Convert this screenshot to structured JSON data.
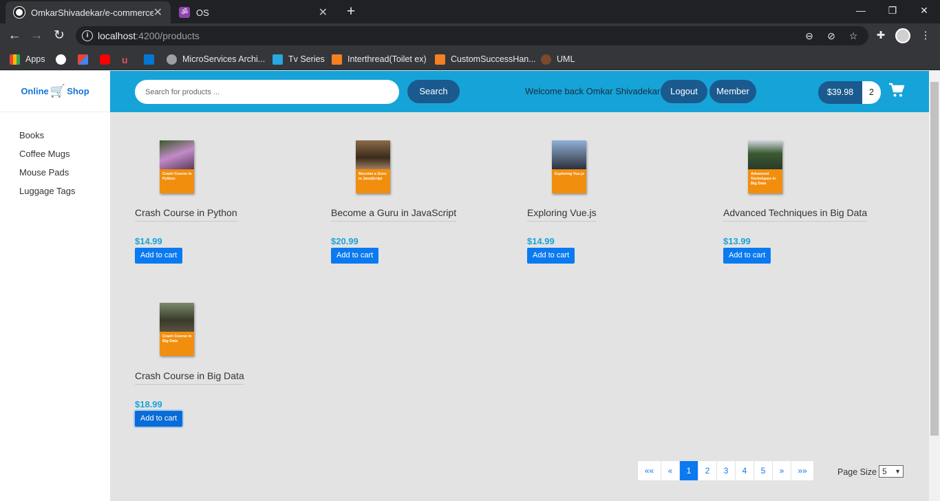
{
  "browser": {
    "tabs": [
      {
        "title": "OmkarShivadekar/e-commerce-a",
        "icon": "github-icon"
      },
      {
        "title": "OS",
        "icon": "om-icon"
      }
    ],
    "url_host": "localhost",
    "url_path": ":4200/products",
    "bookmarks": [
      {
        "label": "Apps",
        "icon": "apps-grid-icon"
      },
      {
        "label": "",
        "icon": "github-icon"
      },
      {
        "label": "",
        "icon": "gmail-icon"
      },
      {
        "label": "",
        "icon": "youtube-icon"
      },
      {
        "label": "",
        "icon": "udemy-icon"
      },
      {
        "label": "",
        "icon": "outlook-icon"
      },
      {
        "label": "MicroServices Archi...",
        "icon": "globe-icon"
      },
      {
        "label": "Tv Series",
        "icon": "tv-icon"
      },
      {
        "label": "Interthread(Toilet ex)",
        "icon": "stackoverflow-icon"
      },
      {
        "label": "CustomSuccessHan...",
        "icon": "stackoverflow-icon"
      },
      {
        "label": "UML",
        "icon": "cloud-icon"
      }
    ]
  },
  "brand": {
    "left": "Online",
    "right": "Shop"
  },
  "categories": [
    "Books",
    "Coffee Mugs",
    "Mouse Pads",
    "Luggage Tags"
  ],
  "header": {
    "search_placeholder": "Search for products ...",
    "search_label": "Search",
    "welcome": "Welcome back Omkar Shivadekar!",
    "logout_label": "Logout",
    "member_label": "Member",
    "cart_total": "$39.98",
    "cart_count": "2"
  },
  "products": [
    {
      "name": "Crash Course in Python",
      "price": "$14.99",
      "cover_title": "Crash Course in Python",
      "add_label": "Add to cart"
    },
    {
      "name": "Become a Guru in JavaScript",
      "price": "$20.99",
      "cover_title": "Become a Guru in JavaScript",
      "add_label": "Add to cart"
    },
    {
      "name": "Exploring Vue.js",
      "price": "$14.99",
      "cover_title": "Exploring Vue.js",
      "add_label": "Add to cart"
    },
    {
      "name": "Advanced Techniques in Big Data",
      "price": "$13.99",
      "cover_title": "Advanced Techniques in Big Data",
      "add_label": "Add to cart"
    },
    {
      "name": "Crash Course in Big Data",
      "price": "$18.99",
      "cover_title": "Crash Course in Big Data",
      "add_label": "Add to cart"
    }
  ],
  "pagination": {
    "first": "««",
    "prev": "«",
    "pages": [
      "1",
      "2",
      "3",
      "4",
      "5"
    ],
    "next": "»",
    "last": "»»",
    "active_page": "1",
    "page_size_label": "Page Size",
    "page_size_value": "5"
  },
  "colors": {
    "header": "#16a3d8",
    "accent": "#0b7af0",
    "price": "#1aa3d9",
    "dark_button": "#1a5a8e"
  }
}
